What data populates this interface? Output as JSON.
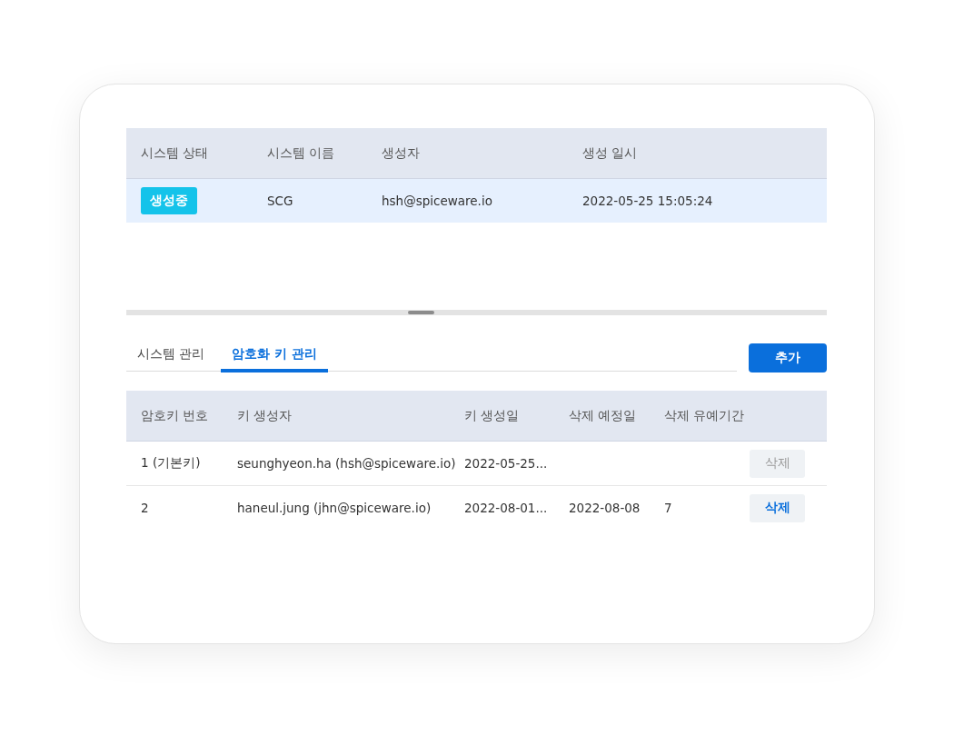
{
  "system_table": {
    "columns": [
      "시스템 상태",
      "시스템 이름",
      "생성자",
      "생성 일시"
    ],
    "rows": [
      {
        "status": "생성중",
        "name": "SCG",
        "creator": "hsh@spiceware.io",
        "created": "2022-05-25 15:05:24",
        "selected": true
      }
    ]
  },
  "tabs": [
    {
      "label": "시스템 관리",
      "selected": false
    },
    {
      "label": "암호화 키 관리",
      "selected": true
    }
  ],
  "add_button": "추가",
  "key_table": {
    "columns": [
      "암호키 번호",
      "키 생성자",
      "키 생성일",
      "삭제 예정일",
      "삭제 유예기간"
    ],
    "rows": [
      {
        "cells": [
          "1 (기본키)",
          "seunghyeon.ha (hsh@spiceware.io)",
          "2022-05-25..."
        ],
        "action": "삭제",
        "disabled": true
      },
      {
        "cells": [
          "2",
          "haneul.jung (jhn@spiceware.io)",
          "2022-08-01...",
          "2022-08-08",
          "7"
        ],
        "action": "삭제",
        "disabled": false
      }
    ]
  }
}
